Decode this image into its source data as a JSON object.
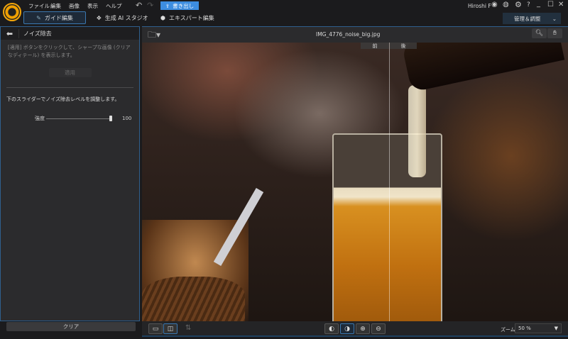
{
  "menu": [
    "ファイル",
    "編集",
    "画像",
    "表示",
    "ヘルプ"
  ],
  "export_label": "書き出し",
  "tabs": [
    "ガイド編集",
    "生成 AI スタジオ",
    "エキスパート編集"
  ],
  "user": "Hiroshi F",
  "manage_label": "管理＆調整",
  "panel": {
    "title": "ノイズ除去",
    "description": "[適用] ボタンをクリックして、シャープな画像 (クリアなディテール) を表示します。",
    "apply": "適用",
    "instruction": "下のスライダーでノイズ除去レベルを調整します。",
    "slider_label": "強度",
    "slider_value": "100",
    "slider_fraction": 1.0,
    "clear": "クリア"
  },
  "file_name": "IMG_4776_noise_big.jpg",
  "compare": {
    "before": "前",
    "after": "後"
  },
  "zoom": {
    "label": "ズーム:",
    "value": "50 %"
  }
}
